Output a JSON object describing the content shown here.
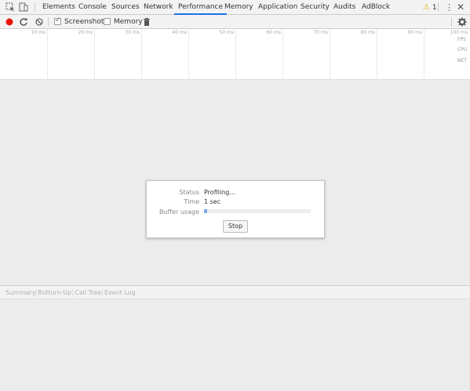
{
  "tabs": [
    "Elements",
    "Console",
    "Sources",
    "Network",
    "Performance",
    "Memory",
    "Application",
    "Security",
    "Audits",
    "AdBlock"
  ],
  "active_tab": "Performance",
  "warnings": {
    "count": "1"
  },
  "toolbar": {
    "screenshots_label": "Screenshots",
    "screenshots_checked": true,
    "memory_label": "Memory",
    "memory_checked": false
  },
  "overview": {
    "ticks": [
      "10 ms",
      "20 ms",
      "30 ms",
      "40 ms",
      "50 ms",
      "60 ms",
      "70 ms",
      "80 ms",
      "90 ms",
      "100 ms"
    ],
    "tracks": [
      "FPS",
      "CPU",
      "NET"
    ]
  },
  "status_dialog": {
    "status_label": "Status",
    "status_value": "Profiling...",
    "time_label": "Time",
    "time_value": "1 sec",
    "buffer_label": "Buffer usage",
    "buffer_fraction": 0.03,
    "stop_label": "Stop"
  },
  "details_tabs": [
    "Summary",
    "Bottom-Up",
    "Call Tree",
    "Event Log"
  ],
  "colors": {
    "record": "#e8150b",
    "accent": "#1a73e8",
    "warning": "#e8a600",
    "buffer_fill": "#7fa7e8"
  }
}
